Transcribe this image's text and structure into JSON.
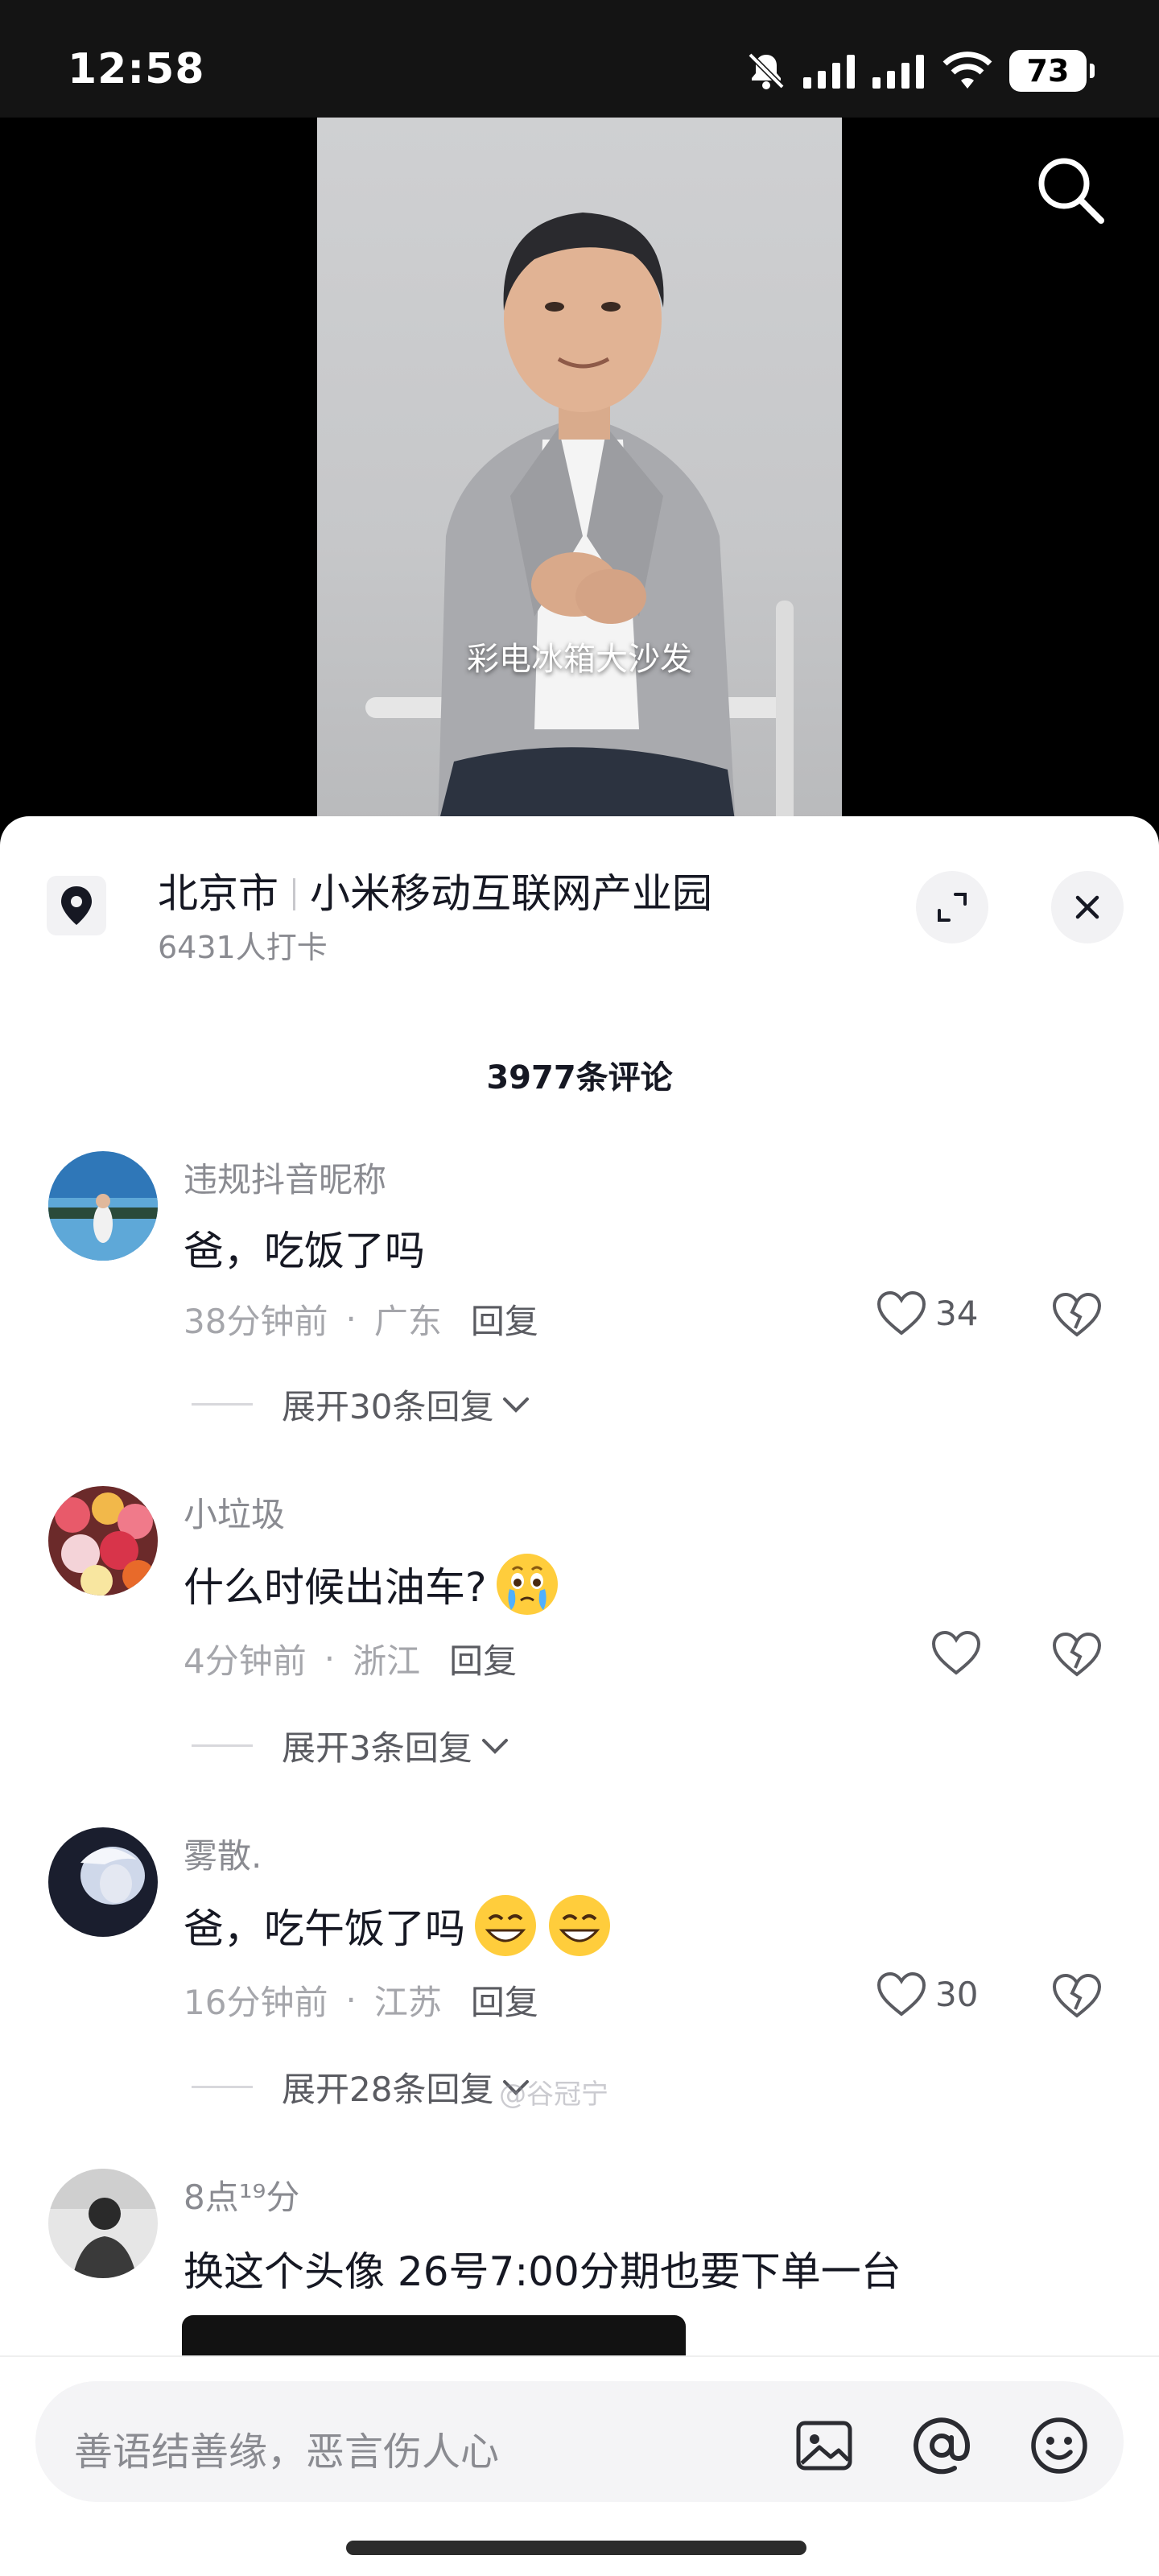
{
  "status_bar": {
    "time": "12:58",
    "battery": "73",
    "icons": [
      "bell-muted-icon",
      "signal-icon",
      "signal-icon",
      "wifi-icon",
      "battery-icon"
    ]
  },
  "video": {
    "subtitle": "彩电冰箱大沙发",
    "search_icon": "search-icon"
  },
  "location": {
    "city": "北京市",
    "place": "小米移动互联网产业园",
    "checkins": "6431人打卡"
  },
  "comments_header": {
    "count_label": "3977条评论"
  },
  "comments": [
    {
      "user": "违规抖音昵称",
      "text": "爸，吃饭了吗",
      "time": "38分钟前",
      "region": "广东",
      "reply_label": "回复",
      "likes": "34",
      "expand_label": "展开30条回复"
    },
    {
      "user": "小垃圾",
      "text": "什么时候出油车?",
      "time": "4分钟前",
      "region": "浙江",
      "reply_label": "回复",
      "likes": "",
      "expand_label": "展开3条回复",
      "emoji": "crying-face-emoji"
    },
    {
      "user": "雾散.",
      "text": "爸，吃午饭了吗",
      "time": "16分钟前",
      "region": "江苏",
      "reply_label": "回复",
      "likes": "30",
      "expand_label": "展开28条回复",
      "emoji": "grinning-face-emoji"
    },
    {
      "user": "8点¹⁹分",
      "text": "换这个头像  26号7:00分期也要下单一台"
    }
  ],
  "watermark": "@谷冠宁",
  "input": {
    "placeholder": "善语结善缘，恶言伤人心"
  },
  "colors": {
    "text_primary": "#161823",
    "text_secondary": "#8a8b91",
    "sheet_bg": "#ffffff"
  }
}
